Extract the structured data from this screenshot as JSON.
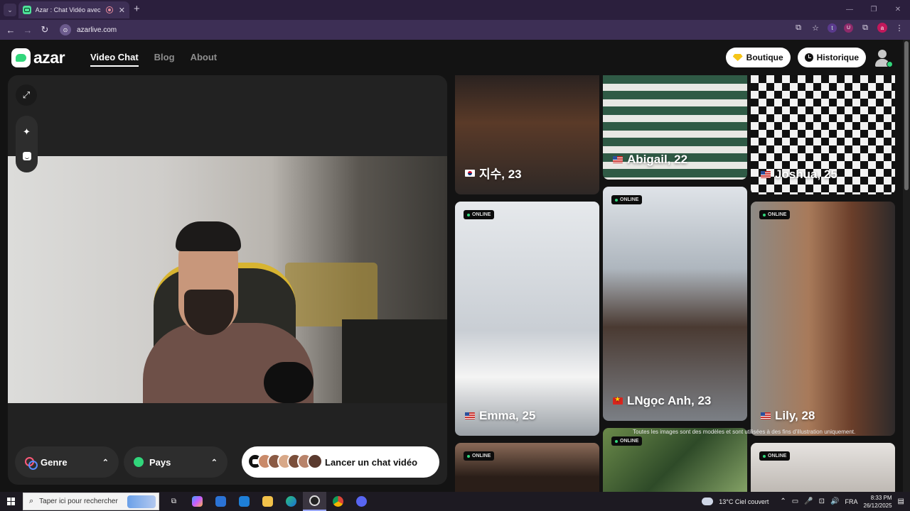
{
  "browser": {
    "tab_title": "Azar : Chat Vidéo avec de n",
    "url": "azarlive.com",
    "menu_glyph": "⌄",
    "close_glyph": "✕",
    "new_tab_glyph": "+",
    "back_glyph": "←",
    "forward_glyph": "→",
    "reload_glyph": "↻",
    "site_glyph": "⊙",
    "window_controls": [
      "—",
      "❐",
      "✕"
    ],
    "toolbar_icons": {
      "install": "⧉",
      "bookmark": "☆",
      "ext_t": "t",
      "ext_u": "U",
      "extensions": "⧉",
      "profile": "a",
      "menu": "⋮"
    }
  },
  "header": {
    "logo_text": "azar",
    "nav": [
      {
        "label": "Video Chat",
        "active": true
      },
      {
        "label": "Blog",
        "active": false
      },
      {
        "label": "About",
        "active": false
      }
    ],
    "shop_label": "Boutique",
    "history_label": "Historique"
  },
  "video_panel": {
    "expand_glyph": "⤢",
    "effects_glyph": "✦",
    "genre_label": "Genre",
    "country_label": "Pays",
    "chevron_glyph": "⌃",
    "launch_label": "Lancer un chat vidéo"
  },
  "cards": [
    {
      "name": "지수, 23",
      "flag": "kr",
      "online": false,
      "bg": "#3a302c"
    },
    {
      "name": "Abigail, 22",
      "flag": "us",
      "online": false,
      "bg": "#6a6a68"
    },
    {
      "name": "Joshua, 25",
      "flag": "us",
      "online": false,
      "bg": "#2a2a2a"
    },
    {
      "name": "Emma, 25",
      "flag": "us",
      "online": true,
      "bg": "#d9dde2"
    },
    {
      "name": "LNgọc Anh, 23",
      "flag": "vn",
      "online": true,
      "bg": "#8a8f96"
    },
    {
      "name": "Lily, 28",
      "flag": "us",
      "online": true,
      "bg": "#7a4a36"
    },
    {
      "name": "",
      "flag": "",
      "online": true,
      "bg": "#3a2e28"
    },
    {
      "name": "",
      "flag": "",
      "online": true,
      "bg": "#4d6b3a"
    },
    {
      "name": "",
      "flag": "",
      "online": true,
      "bg": "#d6d3d0"
    }
  ],
  "online_label": "ONLINE",
  "disclaimer": "Toutes les images sont des modèles et sont utilisées à des fins d'illustration uniquement.",
  "taskbar": {
    "search_placeholder": "Taper ici pour rechercher",
    "search_glyph": "⌕",
    "task_view_glyph": "⧉",
    "weather": "13°C  Ciel couvert",
    "tray_glyphs": [
      "⌃",
      "▭",
      "🎤",
      "⊡",
      "🔊"
    ],
    "language": "FRA",
    "time": "8:33 PM",
    "date": "26/12/2025",
    "notification_glyph": "▤"
  },
  "colors": {
    "accent": "#31d67b",
    "browser_frame": "#3d2f55",
    "page_bg": "#131313"
  }
}
